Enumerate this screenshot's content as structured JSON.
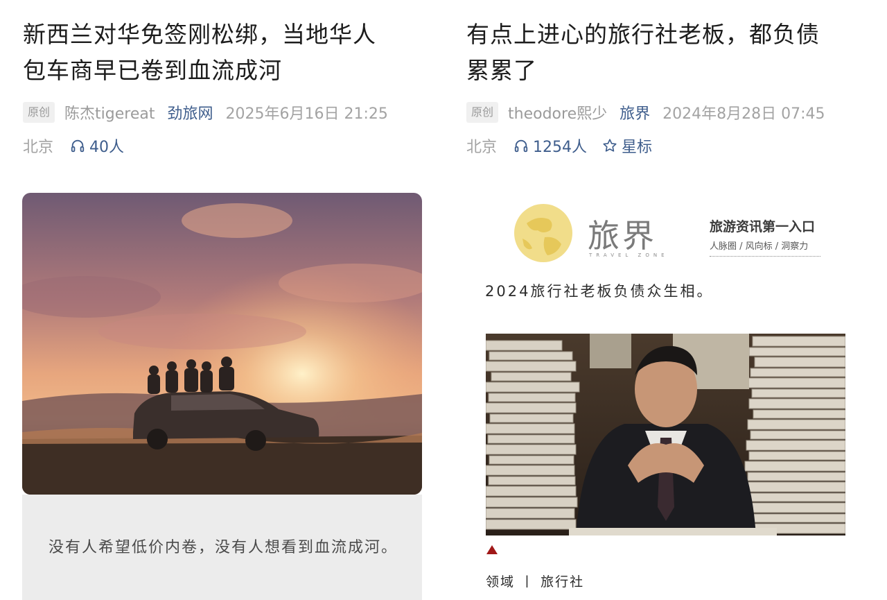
{
  "left_article": {
    "title_line1": "新西兰对华免签刚松绑，当地华人",
    "title_line2": "包车商早已卷到血流成河",
    "badge": "原创",
    "author": "陈杰tigereat",
    "source": "劲旅网",
    "date": "2025年6月16日 21:25",
    "location": "北京",
    "listeners": "40人",
    "listen_icon": "headphones-icon",
    "quote": "没有人希望低价内卷，没有人想看到血流成河。"
  },
  "right_article": {
    "title_line1": "有点上进心的旅行社老板，都负债",
    "title_line2": "累累了",
    "badge": "原创",
    "author": "theodore熙少",
    "source": "旅界",
    "date": "2024年8月28日 07:45",
    "location": "北京",
    "listeners": "1254人",
    "listen_icon": "headphones-icon",
    "star_label": "星标",
    "star_icon": "star-outline-icon",
    "brand": {
      "name": "旅界",
      "sub": "TRAVEL ZONE",
      "slogan": "旅游资讯第一入口",
      "tags": "人脉圈 / 风向标 / 洞察力"
    },
    "body": "2024旅行社老板负债众生相。",
    "field_label": "领域 丨 旅行社"
  },
  "colors": {
    "link_blue": "#3e5d8c",
    "meta_gray": "#a3a3a3",
    "quote_bg": "#ececec",
    "marker_red": "#a01818"
  }
}
